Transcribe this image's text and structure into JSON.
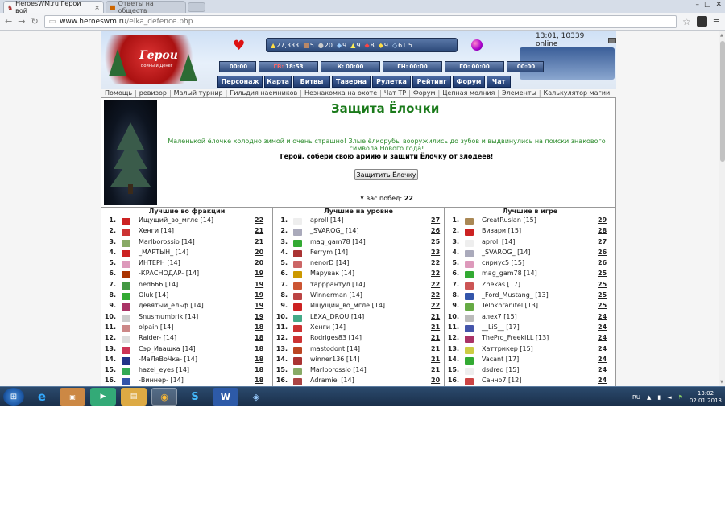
{
  "browser": {
    "tabs": [
      {
        "title": "HeroesWM.ru Герои вой",
        "active": true
      },
      {
        "title": "Ответы на обществ",
        "active": false
      }
    ],
    "url_host": "www.heroeswm.ru",
    "url_path": "/elka_defence.php"
  },
  "header": {
    "resources": [
      "27,333",
      "5",
      "20",
      "9",
      "9",
      "8",
      "9",
      "61.5"
    ],
    "server_time": "13:01, 10339 online",
    "timers": [
      {
        "label": "",
        "value": "00:00"
      },
      {
        "label": "ГВ:",
        "value": "18:53",
        "red": true
      },
      {
        "label": "К:",
        "value": "00:00"
      },
      {
        "label": "ГН:",
        "value": "00:00"
      },
      {
        "label": "ГО:",
        "value": "00:00"
      },
      {
        "label": "",
        "value": "00:00"
      }
    ],
    "nav": [
      "Персонаж",
      "Карта",
      "Битвы",
      "Таверна",
      "Рулетка",
      "Рейтинг",
      "Форум",
      "Чат"
    ]
  },
  "links": [
    "Помощь",
    "ревизор",
    "Малый турнир",
    "Гильдия наемников",
    "Незнакомка на охоте",
    "Чат ТР",
    "Форум",
    "Цепная молния",
    "Элементы",
    "Калькулятор магии"
  ],
  "event": {
    "title": "Защита Ёлочки",
    "description": "Маленькой ёлочке холодно зимой и очень страшно! Злые ёлкорубы вооружились до зубов и выдвинулись на поиски знакового символа Нового года!",
    "call": "Герой, собери свою армию и защити Ёлочку от злодеев!",
    "button": "Защитить Ёлочку",
    "wins_label": "У вас побед:",
    "wins_value": "22"
  },
  "leaderboards": [
    {
      "header": "Лучшие во фракции",
      "rows": [
        {
          "rank": "1.",
          "name": "Ищущий_во_мгле [14]",
          "score": "22",
          "color": "#c22"
        },
        {
          "rank": "2.",
          "name": "Хенги [14]",
          "score": "21",
          "color": "#c33"
        },
        {
          "rank": "3.",
          "name": "Marlborossio [14]",
          "score": "21",
          "color": "#8a6"
        },
        {
          "rank": "4.",
          "name": "_МАРТЫН_ [14]",
          "score": "20",
          "color": "#c22"
        },
        {
          "rank": "5.",
          "name": "ИНТЕРН [14]",
          "score": "20",
          "color": "#d9b"
        },
        {
          "rank": "6.",
          "name": "-КРАСНОДАР- [14]",
          "score": "19",
          "color": "#a30"
        },
        {
          "rank": "7.",
          "name": "ned666 [14]",
          "score": "19",
          "color": "#494"
        },
        {
          "rank": "8.",
          "name": "Oluk [14]",
          "score": "19",
          "color": "#3a3"
        },
        {
          "rank": "9.",
          "name": "девятый_ельф [14]",
          "score": "19",
          "color": "#a36"
        },
        {
          "rank": "10.",
          "name": "Snusmumbrik [14]",
          "score": "19",
          "color": "#ccc"
        },
        {
          "rank": "11.",
          "name": "olpain [14]",
          "score": "18",
          "color": "#c88"
        },
        {
          "rank": "12.",
          "name": "Raider- [14]",
          "score": "18",
          "color": "#ddd"
        },
        {
          "rank": "13.",
          "name": "Сэр_Ивашка [14]",
          "score": "18",
          "color": "#c35"
        },
        {
          "rank": "14.",
          "name": "-МаЛяВоЧка- [14]",
          "score": "18",
          "color": "#238"
        },
        {
          "rank": "15.",
          "name": "hazel_eyes [14]",
          "score": "18",
          "color": "#3a5"
        },
        {
          "rank": "16.",
          "name": "-Виннер- [14]",
          "score": "18",
          "color": "#35a"
        }
      ]
    },
    {
      "header": "Лучшие на уровне",
      "rows": [
        {
          "rank": "1.",
          "name": "aproll [14]",
          "score": "27",
          "color": "#eee"
        },
        {
          "rank": "2.",
          "name": "_SVAROG_ [14]",
          "score": "26",
          "color": "#aab"
        },
        {
          "rank": "3.",
          "name": "mag_gam78 [14]",
          "score": "25",
          "color": "#3a3"
        },
        {
          "rank": "4.",
          "name": "Ferrym [14]",
          "score": "23",
          "color": "#a33"
        },
        {
          "rank": "5.",
          "name": "nenorD [14]",
          "score": "22",
          "color": "#c66"
        },
        {
          "rank": "6.",
          "name": "Марувак [14]",
          "score": "22",
          "color": "#c90"
        },
        {
          "rank": "7.",
          "name": "тарррантул [14]",
          "score": "22",
          "color": "#c53"
        },
        {
          "rank": "8.",
          "name": "Winnerman [14]",
          "score": "22",
          "color": "#b44"
        },
        {
          "rank": "9.",
          "name": "Ищущий_во_мгле [14]",
          "score": "22",
          "color": "#c22"
        },
        {
          "rank": "10.",
          "name": "LEXA_DROU [14]",
          "score": "21",
          "color": "#4a8"
        },
        {
          "rank": "11.",
          "name": "Хенги [14]",
          "score": "21",
          "color": "#c33"
        },
        {
          "rank": "12.",
          "name": "Rodriges83 [14]",
          "score": "21",
          "color": "#c33"
        },
        {
          "rank": "13.",
          "name": "mastodont [14]",
          "score": "21",
          "color": "#b42"
        },
        {
          "rank": "14.",
          "name": "winner136 [14]",
          "score": "21",
          "color": "#a33"
        },
        {
          "rank": "15.",
          "name": "Marlborossio [14]",
          "score": "21",
          "color": "#8a6"
        },
        {
          "rank": "16.",
          "name": "Adramiel [14]",
          "score": "20",
          "color": "#a44"
        }
      ]
    },
    {
      "header": "Лучшие в игре",
      "rows": [
        {
          "rank": "1.",
          "name": "GreatRuslan [15]",
          "score": "29",
          "color": "#a85"
        },
        {
          "rank": "2.",
          "name": "Визари [15]",
          "score": "28",
          "color": "#c22"
        },
        {
          "rank": "3.",
          "name": "aproll [14]",
          "score": "27",
          "color": "#eee"
        },
        {
          "rank": "4.",
          "name": "_SVAROG_ [14]",
          "score": "26",
          "color": "#aab"
        },
        {
          "rank": "5.",
          "name": "сириус5 [15]",
          "score": "26",
          "color": "#d9b"
        },
        {
          "rank": "6.",
          "name": "mag_gam78 [14]",
          "score": "25",
          "color": "#3a3"
        },
        {
          "rank": "7.",
          "name": "Zhekas [17]",
          "score": "25",
          "color": "#c55"
        },
        {
          "rank": "8.",
          "name": "_Ford_Mustang_ [13]",
          "score": "25",
          "color": "#35a"
        },
        {
          "rank": "9.",
          "name": "Telokhranitel [13]",
          "score": "25",
          "color": "#6a4"
        },
        {
          "rank": "10.",
          "name": "алех7 [15]",
          "score": "24",
          "color": "#bbb"
        },
        {
          "rank": "11.",
          "name": "__LiS__ [17]",
          "score": "24",
          "color": "#45a"
        },
        {
          "rank": "12.",
          "name": "ThePro_FreekiLL [13]",
          "score": "24",
          "color": "#a36"
        },
        {
          "rank": "13.",
          "name": "Хаттрикер [15]",
          "score": "24",
          "color": "#cc4"
        },
        {
          "rank": "14.",
          "name": "Vacant [17]",
          "score": "24",
          "color": "#3a3"
        },
        {
          "rank": "15.",
          "name": "dsdred [15]",
          "score": "24",
          "color": "#eee"
        },
        {
          "rank": "16.",
          "name": "Санчо7 [12]",
          "score": "24",
          "color": "#c44"
        }
      ]
    }
  ],
  "taskbar": {
    "lang": "RU",
    "time": "13:02",
    "date": "02.01.2013"
  }
}
